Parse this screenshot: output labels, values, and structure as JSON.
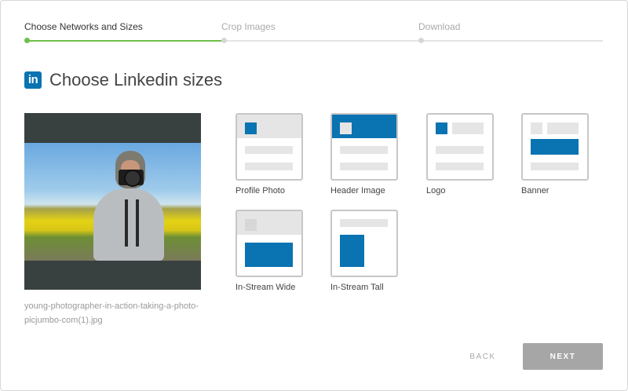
{
  "stepper": {
    "steps": [
      {
        "label": "Choose Networks and Sizes",
        "state": "active"
      },
      {
        "label": "Crop Images",
        "state": "inactive"
      },
      {
        "label": "Download",
        "state": "inactive"
      }
    ]
  },
  "header": {
    "network_icon": "linkedin-icon",
    "network_icon_text": "in",
    "title": "Choose Linkedin sizes"
  },
  "preview": {
    "file_name": "young-photographer-in-action-taking-a-photo-picjumbo-com(1).jpg"
  },
  "sizes": [
    {
      "label": "Profile Photo"
    },
    {
      "label": "Header Image"
    },
    {
      "label": "Logo"
    },
    {
      "label": "Banner"
    },
    {
      "label": "In-Stream Wide"
    },
    {
      "label": "In-Stream Tall"
    }
  ],
  "actions": {
    "back_label": "BACK",
    "next_label": "NEXT"
  },
  "colors": {
    "linkedin_blue": "#0a73b1",
    "progress_green": "#6cc04a",
    "placeholder_grey": "#e5e5e5",
    "next_button": "#a6a6a6"
  }
}
